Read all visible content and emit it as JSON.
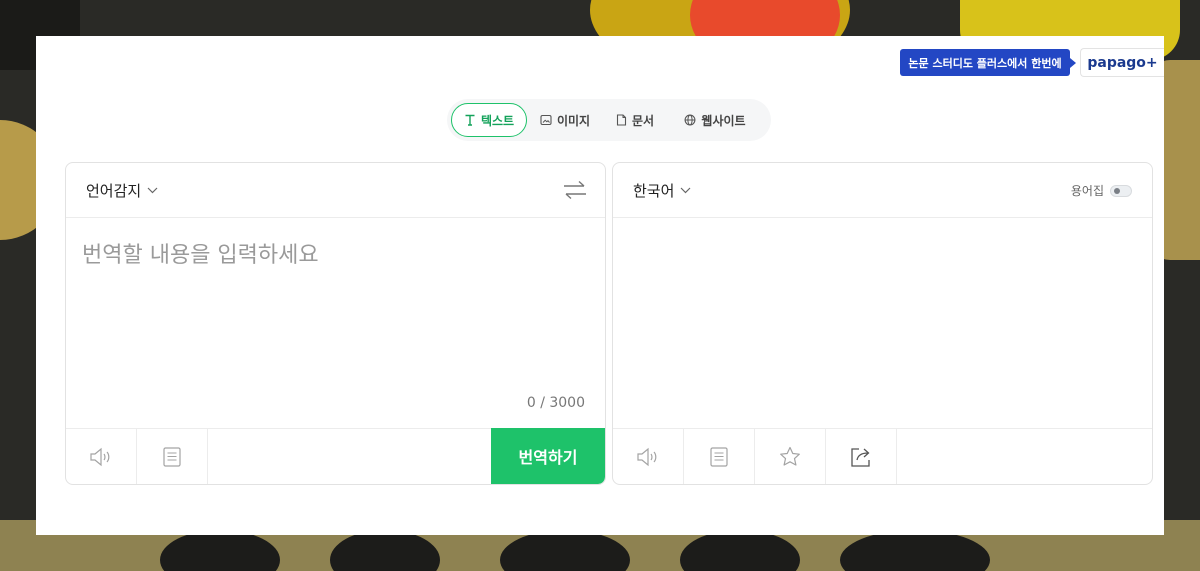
{
  "header": {
    "promo_text": "논문 스터디도 플러스에서 한번에",
    "papago_plus_label": "papago+"
  },
  "tabs": [
    {
      "label": "텍스트",
      "icon": "text-t-icon",
      "active": true
    },
    {
      "label": "이미지",
      "icon": "image-icon",
      "active": false
    },
    {
      "label": "문서",
      "icon": "document-icon",
      "active": false
    },
    {
      "label": "웹사이트",
      "icon": "globe-icon",
      "active": false
    }
  ],
  "source": {
    "language": "언어감지",
    "placeholder": "번역할 내용을 입력하세요",
    "value": "",
    "counter": "0 / 3000",
    "translate_label": "번역하기"
  },
  "target": {
    "language": "한국어",
    "glossary_label": "용어집"
  },
  "colors": {
    "accent": "#1ec26a",
    "promo": "#2347c4",
    "papago": "#1b3a8f"
  }
}
